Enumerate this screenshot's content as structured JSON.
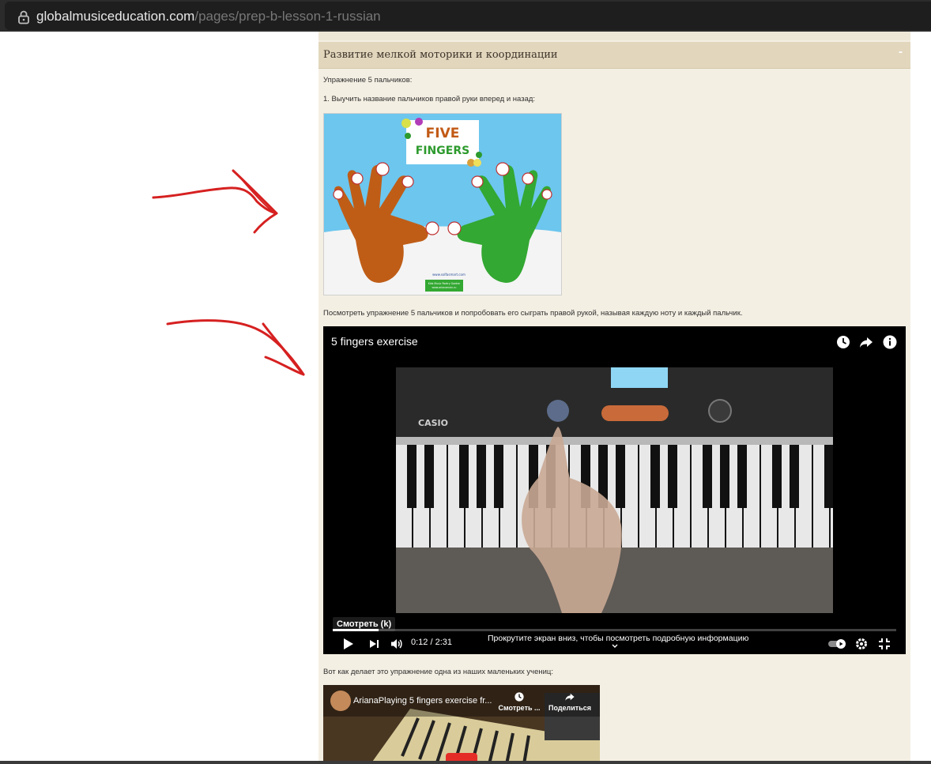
{
  "browser": {
    "url_domain": "globalmusiceducation.com",
    "url_path": "/pages/prep-b-lesson-1-russian",
    "lock_icon": "lock-icon"
  },
  "section": {
    "title": "Развитие мелкой моторики и координации",
    "collapse_label": "-"
  },
  "content": {
    "intro": "Упражнение 5 пальчиков:",
    "step1": "1. Выучить название пальчиков правой руки вперед и назад:",
    "five_fingers_image": {
      "title_line1": "FIVE",
      "title_line2": "FINGERS",
      "website": "www.solfasmart.com",
      "footer_line1": "Kids Music Poetry Garden",
      "footer_line2": "www.arianamain.ru"
    },
    "watch_text": "Посмотреть упражнение 5 пальчиков и попробовать его сыграть правой рукой, называя каждую ноту и каждый пальчик.",
    "student_text": "Вот как делает это упражнение одна из наших маленьких учениц:"
  },
  "video": {
    "title": "5 fingers exercise",
    "watch_later_icon": "clock-icon",
    "share_icon": "share-icon",
    "info_icon": "info-icon",
    "keyboard_brand": "CASIO",
    "watch_label": "Смотреть (k)",
    "time": "0:12 / 2:31",
    "progress_fraction": 0.082,
    "scroll_hint": "Прокрутите экран вниз, чтобы посмотреть подробную информацию",
    "controls": [
      "play-icon",
      "next-icon",
      "volume-icon",
      "autoplay-toggle",
      "settings-icon",
      "exit-fullscreen-icon"
    ]
  },
  "video2": {
    "title": "ArianaPlaying 5 fingers exercise fr...",
    "watch_later_label": "Смотреть ...",
    "share_label": "Поделиться"
  },
  "colors": {
    "content_bg": "#f4efe3",
    "header_bg": "#e2d6bd",
    "annotation_red": "#d62020"
  }
}
